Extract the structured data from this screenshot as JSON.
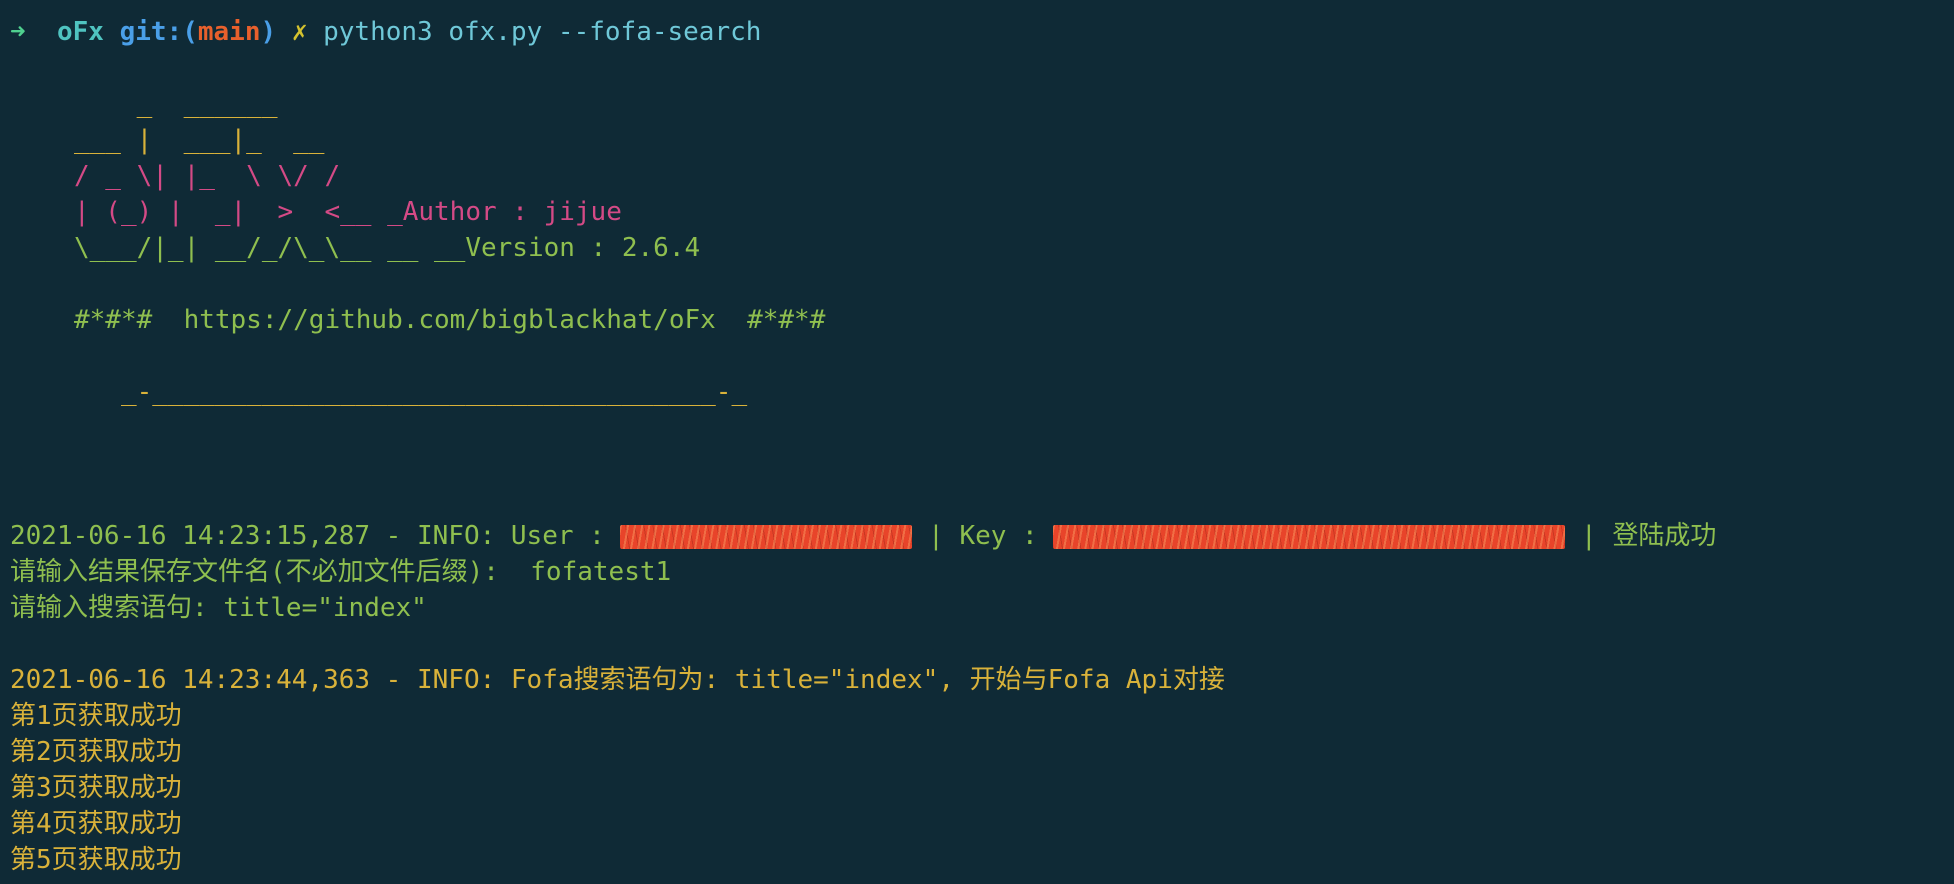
{
  "prompt": {
    "arrow": "➜",
    "dir": "oFx",
    "git_label": "git:",
    "open_paren": "(",
    "branch": "main",
    "close_paren": ")",
    "dirty_mark": "✗",
    "command": "python3 ofx.py --fofa-search"
  },
  "banner": {
    "line1": "    _  ______",
    "line2": "___ |  ___|_  __",
    "line3": "/ _ \\| |_  \\ \\/ /",
    "line4": "| (_) |  _|  >  <__ _Author : jijue",
    "line5": "\\___/|_| __/_/\\_\\__ __ __Version : 2.6.4",
    "url_line": "#*#*#  https://github.com/bigblackhat/oFx  #*#*#",
    "rule_line": "   _-____________________________________-_"
  },
  "log": {
    "login_prefix": "2021-06-16 14:23:15,287 - INFO: User : ",
    "login_mid": " | Key : ",
    "login_suffix": " | 登陆成功",
    "filename_prompt": "请输入结果保存文件名(不必加文件后缀):  ",
    "filename_value": "fofatest1",
    "query_prompt": "请输入搜索语句: ",
    "query_value": "title=\"index\"",
    "search_info": "2021-06-16 14:23:44,363 - INFO: Fofa搜索语句为: title=\"index\", 开始与Fofa Api对接",
    "pages": [
      "第1页获取成功",
      "第2页获取成功",
      "第3页获取成功",
      "第4页获取成功",
      "第5页获取成功"
    ]
  }
}
